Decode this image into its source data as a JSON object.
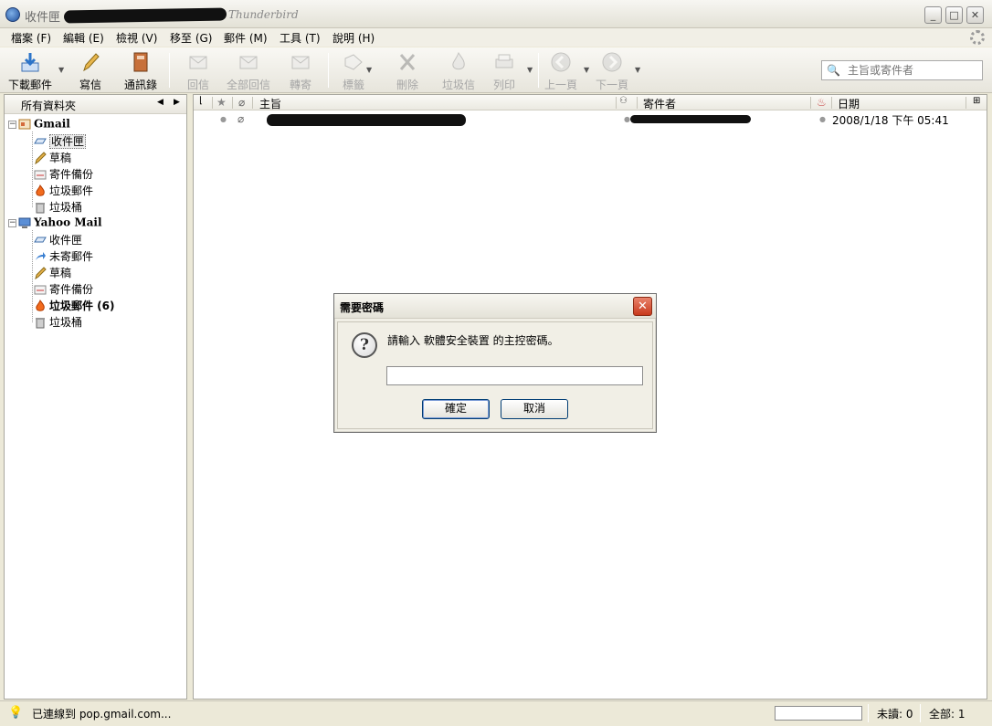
{
  "window": {
    "title": "收件匣",
    "app_name": "Thunderbird",
    "controls": {
      "minimize": "_",
      "maximize": "□",
      "close": "✕"
    }
  },
  "menu": [
    {
      "label": "檔案 (F)"
    },
    {
      "label": "編輯 (E)"
    },
    {
      "label": "檢視 (V)"
    },
    {
      "label": "移至 (G)"
    },
    {
      "label": "郵件 (M)"
    },
    {
      "label": "工具 (T)"
    },
    {
      "label": "說明 (H)"
    }
  ],
  "toolbar": {
    "get_mail": "下載郵件",
    "compose": "寫信",
    "address_book": "通訊錄",
    "reply": "回信",
    "reply_all": "全部回信",
    "forward": "轉寄",
    "tag": "標籤",
    "delete": "刪除",
    "junk": "垃圾信",
    "print": "列印",
    "back": "上一頁",
    "next": "下一頁"
  },
  "search": {
    "placeholder": "主旨或寄件者"
  },
  "folder_pane": {
    "header": "所有資料夾",
    "accounts": [
      {
        "name": "Gmail",
        "folders": [
          {
            "label": "收件匣",
            "icon": "inbox-icon",
            "selected": true
          },
          {
            "label": "草稿",
            "icon": "drafts-icon"
          },
          {
            "label": "寄件備份",
            "icon": "sent-icon"
          },
          {
            "label": "垃圾郵件",
            "icon": "junk-icon"
          },
          {
            "label": "垃圾桶",
            "icon": "trash-icon"
          }
        ]
      },
      {
        "name": "Yahoo Mail",
        "folders": [
          {
            "label": "收件匣",
            "icon": "inbox-icon"
          },
          {
            "label": "未寄郵件",
            "icon": "outbox-icon"
          },
          {
            "label": "草稿",
            "icon": "drafts-icon"
          },
          {
            "label": "寄件備份",
            "icon": "sent-icon"
          },
          {
            "label": "垃圾郵件 (6)",
            "icon": "junk-icon",
            "bold": true
          },
          {
            "label": "垃圾桶",
            "icon": "trash-icon"
          }
        ]
      }
    ]
  },
  "thread_pane": {
    "columns": {
      "subject": "主旨",
      "sender": "寄件者",
      "date": "日期"
    },
    "messages": [
      {
        "date": "2008/1/18 下午 05:41",
        "has_attachment": true
      }
    ]
  },
  "status_bar": {
    "text": "已連線到 pop.gmail.com...",
    "unread": "未讀: 0",
    "total": "全部: 1"
  },
  "dialog": {
    "title": "需要密碼",
    "message": "請輸入 軟體安全裝置 的主控密碼。",
    "password_value": "",
    "ok": "確定",
    "cancel": "取消",
    "close": "✕"
  },
  "colors": {
    "chrome": "#ece9d8",
    "dialog_close": "#c8391c",
    "button_border": "#003c74"
  }
}
